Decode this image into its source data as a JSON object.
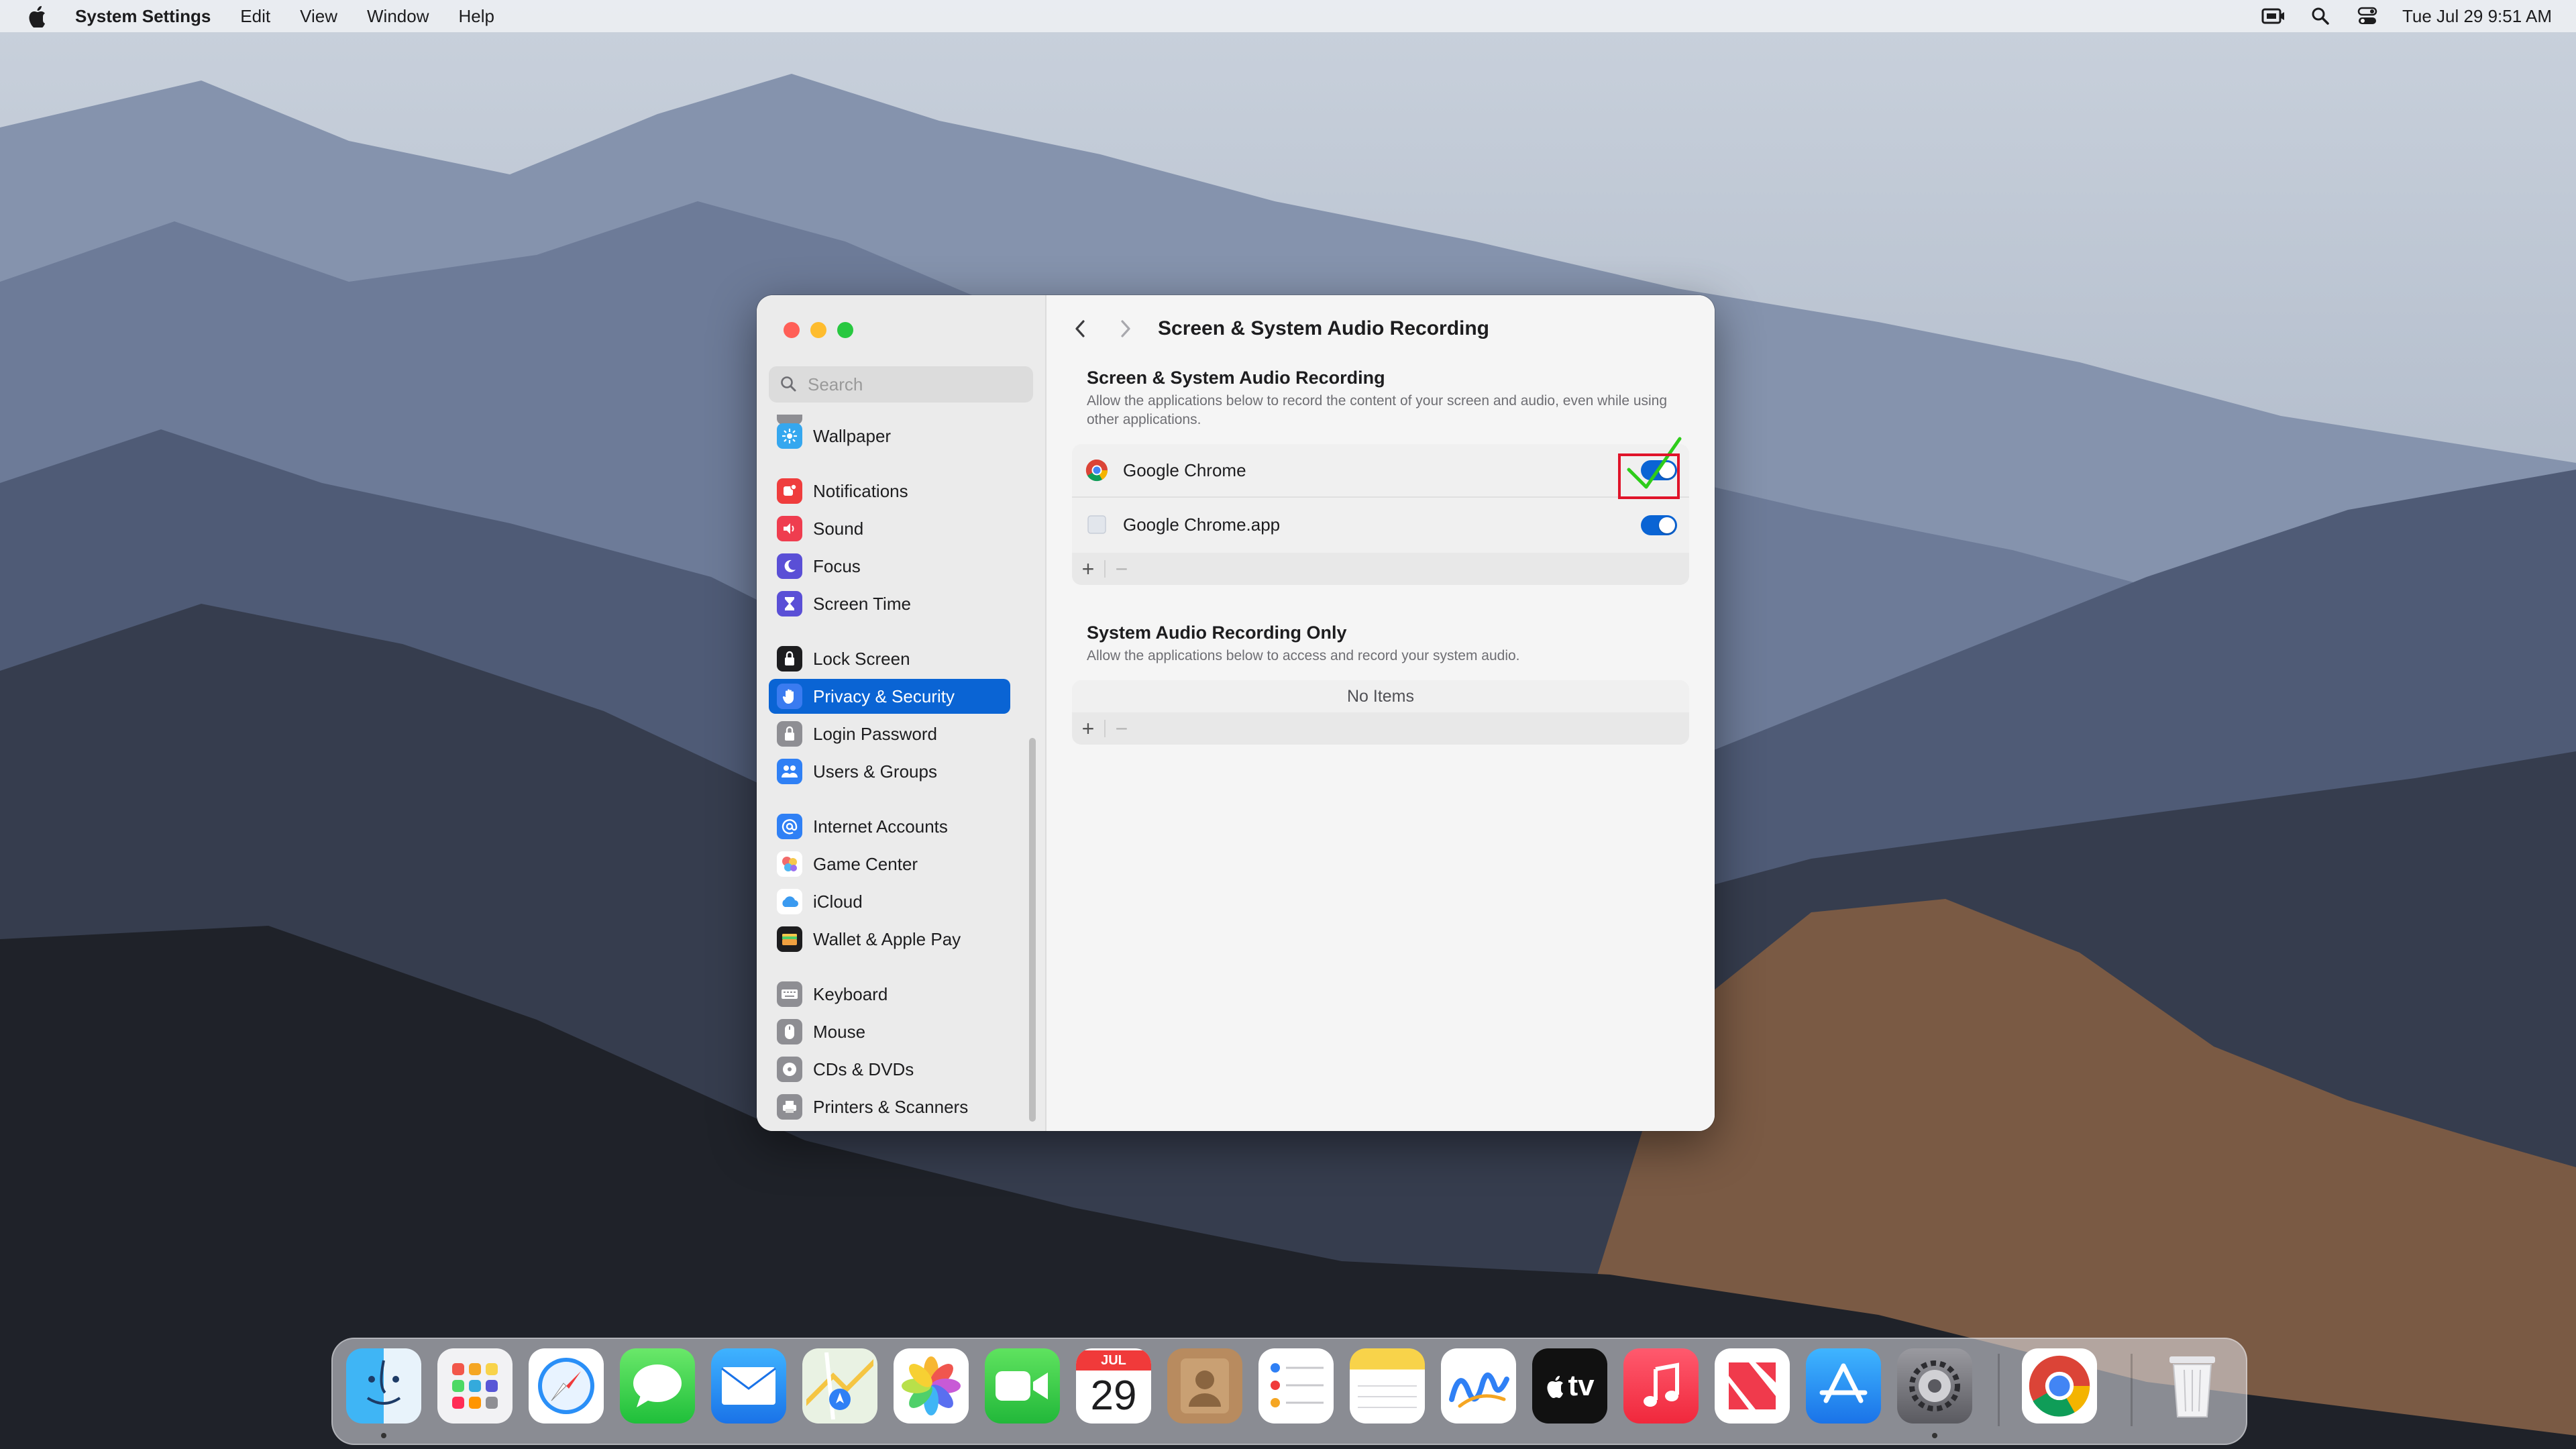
{
  "menubar": {
    "app_name": "System Settings",
    "menus": [
      "Edit",
      "View",
      "Window",
      "Help"
    ],
    "clock": "Tue Jul 29  9:51 AM",
    "status_icons": [
      "screen-record-icon",
      "spotlight-search-icon",
      "control-center-icon"
    ]
  },
  "window": {
    "search": {
      "placeholder": "Search",
      "value": ""
    },
    "sidebar": {
      "items": [
        {
          "label": "Wallpaper",
          "icon": "wallpaper-icon",
          "color": "#35a7ef",
          "selected": false
        },
        {
          "label": "Notifications",
          "icon": "notifications-icon",
          "color": "#ef3d3d",
          "selected": false
        },
        {
          "label": "Sound",
          "icon": "sound-icon",
          "color": "#ef3d4f",
          "selected": false
        },
        {
          "label": "Focus",
          "icon": "focus-icon",
          "color": "#5a4fd6",
          "selected": false
        },
        {
          "label": "Screen Time",
          "icon": "screen-time-icon",
          "color": "#5a4fd6",
          "selected": false
        },
        {
          "label": "Lock Screen",
          "icon": "lock-screen-icon",
          "color": "#1d1d1f",
          "selected": false
        },
        {
          "label": "Privacy & Security",
          "icon": "privacy-hand-icon",
          "color": "#3a7bf0",
          "selected": true
        },
        {
          "label": "Login Password",
          "icon": "login-password-icon",
          "color": "#8e8e93",
          "selected": false
        },
        {
          "label": "Users & Groups",
          "icon": "users-groups-icon",
          "color": "#2f80f5",
          "selected": false
        },
        {
          "label": "Internet Accounts",
          "icon": "internet-accounts-icon",
          "color": "#2f80f5",
          "selected": false
        },
        {
          "label": "Game Center",
          "icon": "game-center-icon",
          "color": "#ffffff",
          "selected": false
        },
        {
          "label": "iCloud",
          "icon": "icloud-icon",
          "color": "#ffffff",
          "selected": false
        },
        {
          "label": "Wallet & Apple Pay",
          "icon": "wallet-icon",
          "color": "#1d1d1f",
          "selected": false
        },
        {
          "label": "Keyboard",
          "icon": "keyboard-icon",
          "color": "#8e8e93",
          "selected": false
        },
        {
          "label": "Mouse",
          "icon": "mouse-icon",
          "color": "#8e8e93",
          "selected": false
        },
        {
          "label": "CDs & DVDs",
          "icon": "cds-dvds-icon",
          "color": "#8e8e93",
          "selected": false
        },
        {
          "label": "Printers & Scanners",
          "icon": "printers-scanners-icon",
          "color": "#8e8e93",
          "selected": false
        }
      ]
    },
    "main": {
      "title": "Screen & System Audio Recording",
      "section1": {
        "title": "Screen & System Audio Recording",
        "description": "Allow the applications below to record the content of your screen and audio, even while using other applications.",
        "apps": [
          {
            "name": "Google Chrome",
            "icon": "chrome-icon",
            "enabled": true
          },
          {
            "name": "Google Chrome.app",
            "icon": "generic-app-icon",
            "enabled": true
          }
        ]
      },
      "section2": {
        "title": "System Audio Recording Only",
        "description": "Allow the applications below to access and record your system audio.",
        "empty_text": "No Items"
      },
      "plus_label": "+",
      "minus_label": "−"
    }
  },
  "dock": {
    "apps": [
      {
        "name": "Finder",
        "icon": "finder-icon",
        "running": true
      },
      {
        "name": "Launchpad",
        "icon": "launchpad-icon",
        "running": false
      },
      {
        "name": "Safari",
        "icon": "safari-icon",
        "running": false
      },
      {
        "name": "Messages",
        "icon": "messages-icon",
        "running": false
      },
      {
        "name": "Mail",
        "icon": "mail-icon",
        "running": false
      },
      {
        "name": "Maps",
        "icon": "maps-icon",
        "running": false
      },
      {
        "name": "Photos",
        "icon": "photos-icon",
        "running": false
      },
      {
        "name": "FaceTime",
        "icon": "facetime-icon",
        "running": false
      },
      {
        "name": "Calendar",
        "icon": "calendar-icon",
        "running": false,
        "month": "JUL",
        "day": "29"
      },
      {
        "name": "Contacts",
        "icon": "contacts-icon",
        "running": false
      },
      {
        "name": "Reminders",
        "icon": "reminders-icon",
        "running": false
      },
      {
        "name": "Notes",
        "icon": "notes-icon",
        "running": false
      },
      {
        "name": "Freeform",
        "icon": "freeform-icon",
        "running": false
      },
      {
        "name": "Apple TV",
        "icon": "apple-tv-icon",
        "running": false,
        "label": "tv"
      },
      {
        "name": "Music",
        "icon": "music-icon",
        "running": false
      },
      {
        "name": "News",
        "icon": "news-icon",
        "running": false
      },
      {
        "name": "App Store",
        "icon": "app-store-icon",
        "running": false
      },
      {
        "name": "System Settings",
        "icon": "system-settings-icon",
        "running": true
      },
      {
        "name": "Google Chrome",
        "icon": "chrome-icon",
        "running": false
      },
      {
        "name": "Trash",
        "icon": "trash-icon",
        "running": false
      }
    ]
  }
}
